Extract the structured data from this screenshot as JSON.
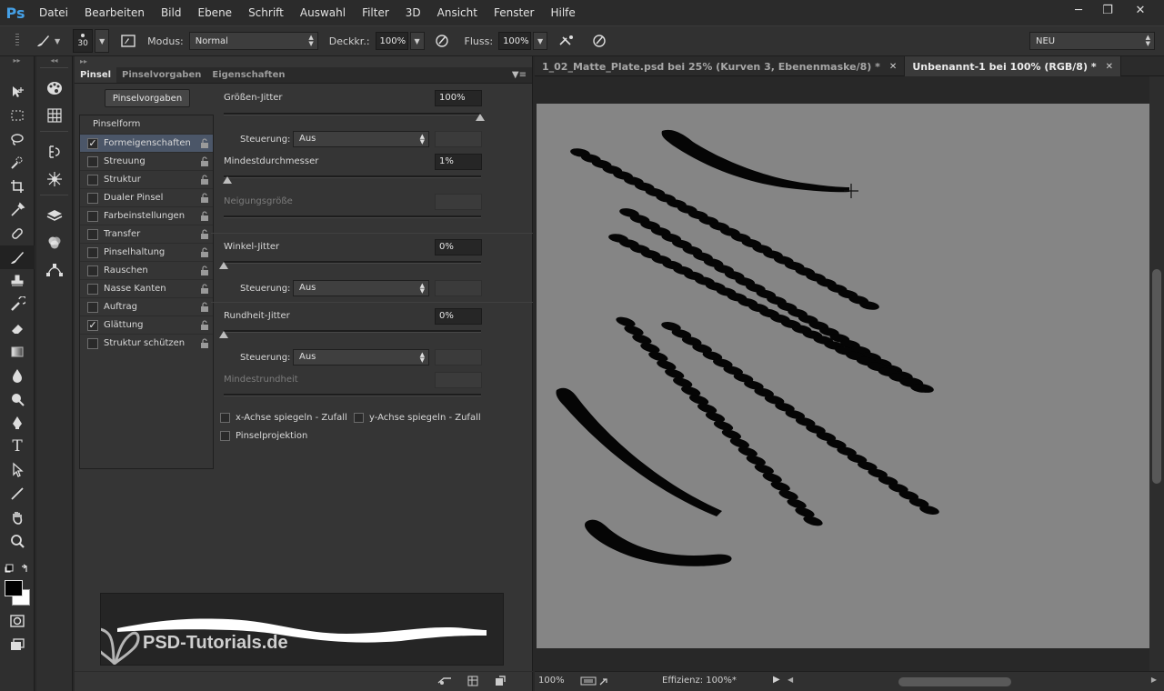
{
  "app": {
    "logo": "Ps",
    "menu": [
      "Datei",
      "Bearbeiten",
      "Bild",
      "Ebene",
      "Schrift",
      "Auswahl",
      "Filter",
      "3D",
      "Ansicht",
      "Fenster",
      "Hilfe"
    ]
  },
  "options": {
    "brush_size": "30",
    "mode_label": "Modus:",
    "mode_value": "Normal",
    "opacity_label": "Deckkr.:",
    "opacity_value": "100%",
    "flow_label": "Fluss:",
    "flow_value": "100%",
    "workspace": "NEU"
  },
  "panel": {
    "tabs": [
      "Pinsel",
      "Pinselvorgaben",
      "Eigenschaften"
    ],
    "presets_button": "Pinselvorgaben",
    "list_header": "Pinselform",
    "items": [
      {
        "label": "Formeigenschaften",
        "checked": true,
        "selected": true
      },
      {
        "label": "Streuung",
        "checked": false
      },
      {
        "label": "Struktur",
        "checked": false
      },
      {
        "label": "Dualer Pinsel",
        "checked": false
      },
      {
        "label": "Farbeinstellungen",
        "checked": false
      },
      {
        "label": "Transfer",
        "checked": false
      },
      {
        "label": "Pinselhaltung",
        "checked": false
      },
      {
        "label": "Rauschen",
        "checked": false
      },
      {
        "label": "Nasse Kanten",
        "checked": false
      },
      {
        "label": "Auftrag",
        "checked": false
      },
      {
        "label": "Glättung",
        "checked": true
      },
      {
        "label": "Struktur schützen",
        "checked": false
      }
    ],
    "settings": {
      "size_jitter_label": "Größen-Jitter",
      "size_jitter_value": "100%",
      "control_label": "Steuerung:",
      "control_value": "Aus",
      "min_diameter_label": "Mindestdurchmesser",
      "min_diameter_value": "1%",
      "tilt_scale_label": "Neigungsgröße",
      "angle_jitter_label": "Winkel-Jitter",
      "angle_jitter_value": "0%",
      "roundness_jitter_label": "Rundheit-Jitter",
      "roundness_jitter_value": "0%",
      "min_roundness_label": "Mindestrundheit",
      "flip_x_label": "x-Achse spiegeln - Zufall",
      "flip_y_label": "y-Achse spiegeln - Zufall",
      "projection_label": "Pinselprojektion"
    },
    "watermark": "PSD-Tutorials.de"
  },
  "document": {
    "tabs": [
      {
        "label": "1_02_Matte_Plate.psd bei 25% (Kurven 3, Ebenenmaske/8) *",
        "active": false
      },
      {
        "label": "Unbenannt-1 bei 100% (RGB/8) *",
        "active": true
      }
    ],
    "zoom": "100%",
    "efficiency": "Effizienz: 100%*"
  }
}
